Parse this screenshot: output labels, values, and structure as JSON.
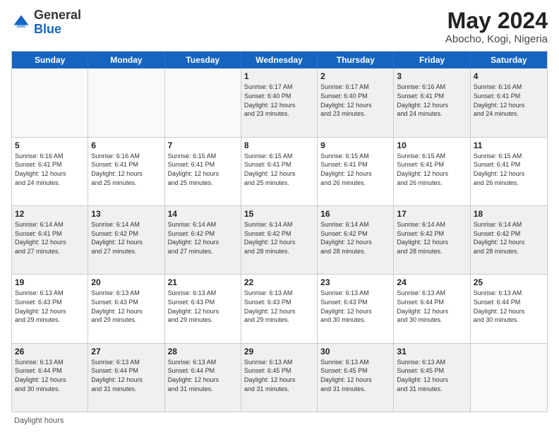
{
  "header": {
    "logo_general": "General",
    "logo_blue": "Blue",
    "month_year": "May 2024",
    "location": "Abocho, Kogi, Nigeria"
  },
  "weekdays": [
    "Sunday",
    "Monday",
    "Tuesday",
    "Wednesday",
    "Thursday",
    "Friday",
    "Saturday"
  ],
  "rows": [
    [
      {
        "day": "",
        "info": "",
        "empty": true
      },
      {
        "day": "",
        "info": "",
        "empty": true
      },
      {
        "day": "",
        "info": "",
        "empty": true
      },
      {
        "day": "1",
        "info": "Sunrise: 6:17 AM\nSunset: 6:40 PM\nDaylight: 12 hours\nand 23 minutes.",
        "empty": false
      },
      {
        "day": "2",
        "info": "Sunrise: 6:17 AM\nSunset: 6:40 PM\nDaylight: 12 hours\nand 23 minutes.",
        "empty": false
      },
      {
        "day": "3",
        "info": "Sunrise: 6:16 AM\nSunset: 6:41 PM\nDaylight: 12 hours\nand 24 minutes.",
        "empty": false
      },
      {
        "day": "4",
        "info": "Sunrise: 6:16 AM\nSunset: 6:41 PM\nDaylight: 12 hours\nand 24 minutes.",
        "empty": false
      }
    ],
    [
      {
        "day": "5",
        "info": "Sunrise: 6:16 AM\nSunset: 6:41 PM\nDaylight: 12 hours\nand 24 minutes.",
        "empty": false
      },
      {
        "day": "6",
        "info": "Sunrise: 6:16 AM\nSunset: 6:41 PM\nDaylight: 12 hours\nand 25 minutes.",
        "empty": false
      },
      {
        "day": "7",
        "info": "Sunrise: 6:15 AM\nSunset: 6:41 PM\nDaylight: 12 hours\nand 25 minutes.",
        "empty": false
      },
      {
        "day": "8",
        "info": "Sunrise: 6:15 AM\nSunset: 6:41 PM\nDaylight: 12 hours\nand 25 minutes.",
        "empty": false
      },
      {
        "day": "9",
        "info": "Sunrise: 6:15 AM\nSunset: 6:41 PM\nDaylight: 12 hours\nand 26 minutes.",
        "empty": false
      },
      {
        "day": "10",
        "info": "Sunrise: 6:15 AM\nSunset: 6:41 PM\nDaylight: 12 hours\nand 26 minutes.",
        "empty": false
      },
      {
        "day": "11",
        "info": "Sunrise: 6:15 AM\nSunset: 6:41 PM\nDaylight: 12 hours\nand 26 minutes.",
        "empty": false
      }
    ],
    [
      {
        "day": "12",
        "info": "Sunrise: 6:14 AM\nSunset: 6:41 PM\nDaylight: 12 hours\nand 27 minutes.",
        "empty": false
      },
      {
        "day": "13",
        "info": "Sunrise: 6:14 AM\nSunset: 6:42 PM\nDaylight: 12 hours\nand 27 minutes.",
        "empty": false
      },
      {
        "day": "14",
        "info": "Sunrise: 6:14 AM\nSunset: 6:42 PM\nDaylight: 12 hours\nand 27 minutes.",
        "empty": false
      },
      {
        "day": "15",
        "info": "Sunrise: 6:14 AM\nSunset: 6:42 PM\nDaylight: 12 hours\nand 28 minutes.",
        "empty": false
      },
      {
        "day": "16",
        "info": "Sunrise: 6:14 AM\nSunset: 6:42 PM\nDaylight: 12 hours\nand 28 minutes.",
        "empty": false
      },
      {
        "day": "17",
        "info": "Sunrise: 6:14 AM\nSunset: 6:42 PM\nDaylight: 12 hours\nand 28 minutes.",
        "empty": false
      },
      {
        "day": "18",
        "info": "Sunrise: 6:14 AM\nSunset: 6:42 PM\nDaylight: 12 hours\nand 28 minutes.",
        "empty": false
      }
    ],
    [
      {
        "day": "19",
        "info": "Sunrise: 6:13 AM\nSunset: 6:43 PM\nDaylight: 12 hours\nand 29 minutes.",
        "empty": false
      },
      {
        "day": "20",
        "info": "Sunrise: 6:13 AM\nSunset: 6:43 PM\nDaylight: 12 hours\nand 29 minutes.",
        "empty": false
      },
      {
        "day": "21",
        "info": "Sunrise: 6:13 AM\nSunset: 6:43 PM\nDaylight: 12 hours\nand 29 minutes.",
        "empty": false
      },
      {
        "day": "22",
        "info": "Sunrise: 6:13 AM\nSunset: 6:43 PM\nDaylight: 12 hours\nand 29 minutes.",
        "empty": false
      },
      {
        "day": "23",
        "info": "Sunrise: 6:13 AM\nSunset: 6:43 PM\nDaylight: 12 hours\nand 30 minutes.",
        "empty": false
      },
      {
        "day": "24",
        "info": "Sunrise: 6:13 AM\nSunset: 6:44 PM\nDaylight: 12 hours\nand 30 minutes.",
        "empty": false
      },
      {
        "day": "25",
        "info": "Sunrise: 6:13 AM\nSunset: 6:44 PM\nDaylight: 12 hours\nand 30 minutes.",
        "empty": false
      }
    ],
    [
      {
        "day": "26",
        "info": "Sunrise: 6:13 AM\nSunset: 6:44 PM\nDaylight: 12 hours\nand 30 minutes.",
        "empty": false
      },
      {
        "day": "27",
        "info": "Sunrise: 6:13 AM\nSunset: 6:44 PM\nDaylight: 12 hours\nand 31 minutes.",
        "empty": false
      },
      {
        "day": "28",
        "info": "Sunrise: 6:13 AM\nSunset: 6:44 PM\nDaylight: 12 hours\nand 31 minutes.",
        "empty": false
      },
      {
        "day": "29",
        "info": "Sunrise: 6:13 AM\nSunset: 6:45 PM\nDaylight: 12 hours\nand 31 minutes.",
        "empty": false
      },
      {
        "day": "30",
        "info": "Sunrise: 6:13 AM\nSunset: 6:45 PM\nDaylight: 12 hours\nand 31 minutes.",
        "empty": false
      },
      {
        "day": "31",
        "info": "Sunrise: 6:13 AM\nSunset: 6:45 PM\nDaylight: 12 hours\nand 31 minutes.",
        "empty": false
      },
      {
        "day": "",
        "info": "",
        "empty": true
      }
    ]
  ],
  "footer": {
    "daylight_label": "Daylight hours"
  },
  "colors": {
    "header_bg": "#1565c0",
    "header_text": "#ffffff",
    "border": "#cccccc",
    "shaded": "#f0f0f0",
    "accent_blue": "#1565c0"
  }
}
